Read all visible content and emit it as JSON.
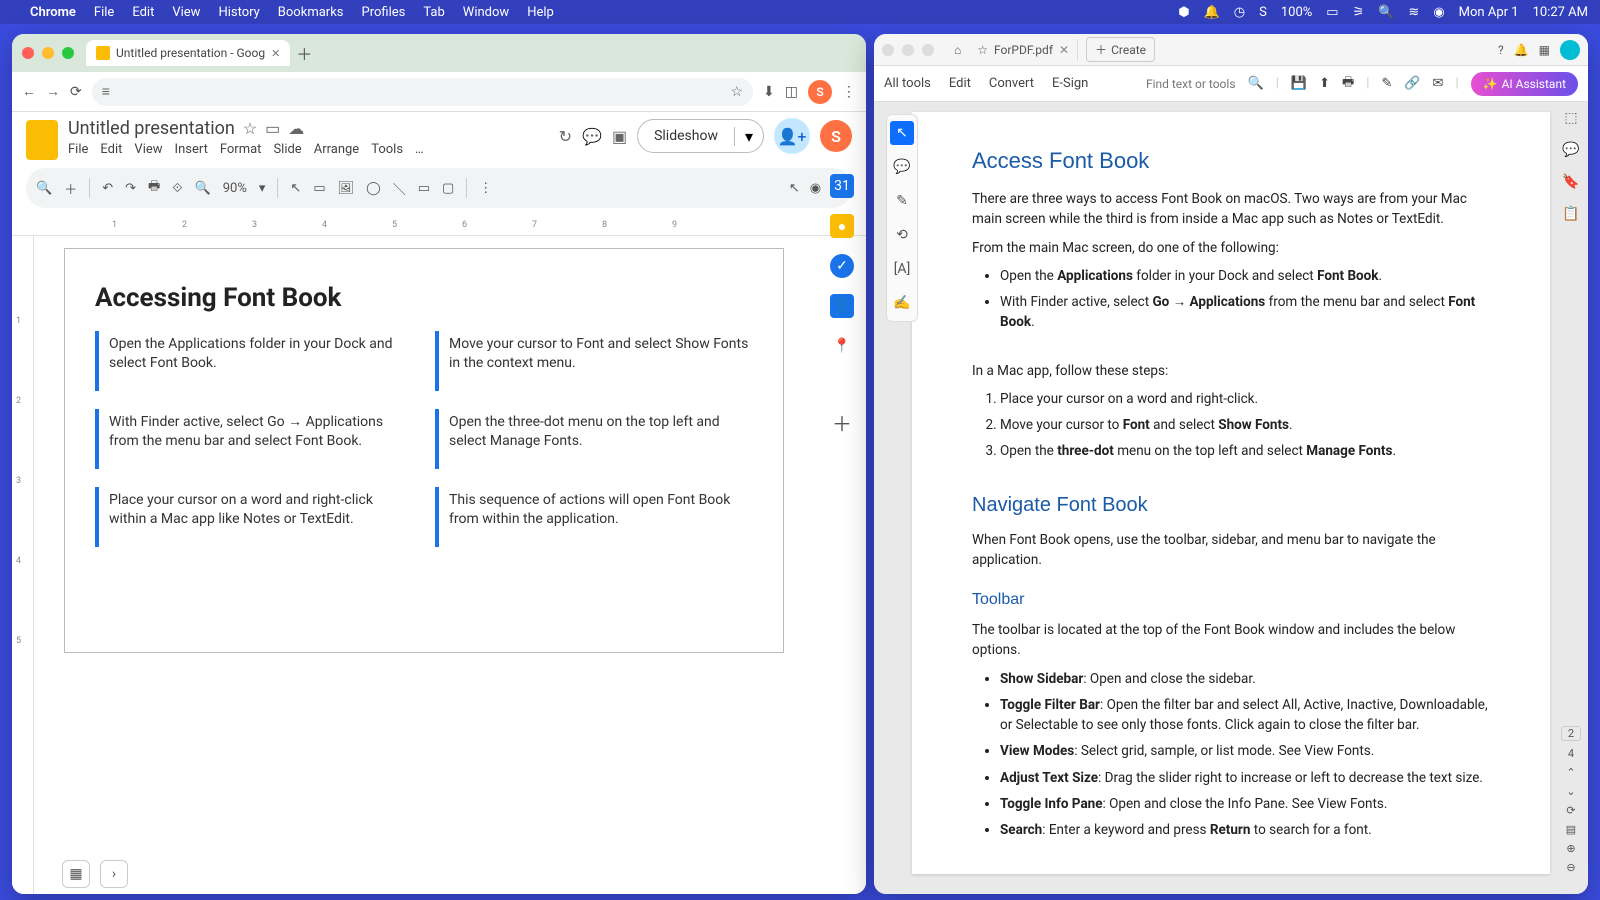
{
  "menubar": {
    "app": "Chrome",
    "items": [
      "File",
      "Edit",
      "View",
      "History",
      "Bookmarks",
      "Profiles",
      "Tab",
      "Window",
      "Help"
    ],
    "battery": "100%",
    "date": "Mon Apr 1",
    "time": "10:27 AM"
  },
  "chrome": {
    "tab_title": "Untitled presentation - Goog",
    "nav_icons": {
      "back": "←",
      "forward": "→",
      "reload": "⟳",
      "tune": "≡"
    },
    "addr_icons": {
      "star": "☆",
      "download": "⬇",
      "sidepanel": "◫",
      "menu": "⋮"
    },
    "avatar": "S"
  },
  "slides": {
    "doc_title": "Untitled presentation",
    "star": "☆",
    "folder": "▭",
    "cloud": "☁",
    "menus": [
      "File",
      "Edit",
      "View",
      "Insert",
      "Format",
      "Slide",
      "Arrange",
      "Tools",
      "…"
    ],
    "history": "↻",
    "comments": "💬",
    "meet": "▣",
    "slideshow": "Slideshow",
    "dd": "▾",
    "share": "👤+",
    "avatar": "S",
    "toolbar": {
      "search": "🔍",
      "new": "＋",
      "undo": "↶",
      "redo": "↷",
      "print": "🖶",
      "paint": "⟐",
      "zoomicon": "🔍",
      "zoom": "90%",
      "dd": "▾",
      "select": "↖",
      "textbox": "▭",
      "image": "🖼",
      "shape": "◯",
      "line": "＼",
      "connector": "▭",
      "transition": "▢",
      "more": "⋮",
      "cursor": "↖",
      "record": "◉",
      "collapse": "⌃"
    },
    "slide": {
      "title": "Accessing Font Book",
      "cards": [
        "Open the Applications folder in your Dock and select Font Book.",
        "Move your cursor to Font and select Show Fonts in the context menu.",
        "With Finder active, select Go → Applications from the menu bar and select Font Book.",
        "Open the three-dot menu on the top left and select Manage Fonts.",
        "Place your cursor on a word and right-click within a Mac app like Notes or TextEdit.",
        "This sequence of actions will open Font Book from within the application."
      ]
    },
    "ruler_h": [
      "1",
      "2",
      "3",
      "4",
      "5",
      "6",
      "7",
      "8",
      "9"
    ],
    "ruler_v": [
      "1",
      "2",
      "3",
      "4",
      "5"
    ]
  },
  "acrobat": {
    "home": "⌂",
    "star": "☆",
    "doc": "ForPDF.pdf",
    "close": "✕",
    "create": "Create",
    "top_icons": {
      "help": "?",
      "bell": "🔔",
      "grid": "▦"
    },
    "tabs": [
      "All tools",
      "Edit",
      "Convert",
      "E-Sign"
    ],
    "find": "Find text or tools",
    "search": "🔍",
    "tool_icons": [
      "💾",
      "⬆",
      "🖶",
      "",
      "✎",
      "🔗",
      "✉"
    ],
    "ai": "AI Assistant",
    "left_tools": [
      "↖",
      "💬",
      "✎",
      "⟲",
      "[A]",
      "✍"
    ],
    "right_tools": [
      "⬚",
      "💬",
      "🔖",
      "📋"
    ],
    "page": {
      "current": "2",
      "total": "4",
      "up": "⌃",
      "down": "⌄",
      "refresh": "⟳",
      "export": "▤",
      "zin": "⊕",
      "zout": "⊖"
    },
    "content": {
      "h1": "Access Font Book",
      "p1": "There are three ways to access Font Book on macOS. Two ways are from your Mac main screen while the third is from inside a Mac app such as Notes or TextEdit.",
      "p2": "From the main Mac screen, do one of the following:",
      "b1_pre": "Open the ",
      "b1_b1": "Applications",
      "b1_mid": " folder in your Dock and select ",
      "b1_b2": "Font Book",
      "b1_end": ".",
      "b2_pre": "With Finder active, select ",
      "b2_b1": "Go → Applications",
      "b2_mid": " from the menu bar and select ",
      "b2_b2": "Font Book",
      "b2_end": ".",
      "p3": "In a Mac app, follow these steps:",
      "ol1": "Place your cursor on a word and right-click.",
      "ol2_pre": "Move your cursor to ",
      "ol2_b1": "Font",
      "ol2_mid": " and select ",
      "ol2_b2": "Show Fonts",
      "ol2_end": ".",
      "ol3_pre": "Open the ",
      "ol3_b1": "three-dot",
      "ol3_mid": " menu on the top left and select ",
      "ol3_b2": "Manage Fonts",
      "ol3_end": ".",
      "h2": "Navigate Font Book",
      "p4": "When Font Book opens, use the toolbar, sidebar, and menu bar to navigate the application.",
      "h3": "Toolbar",
      "p5": "The toolbar is located at the top of the Font Book window and includes the below options.",
      "tb1_b": "Show Sidebar",
      "tb1": ": Open and close the sidebar.",
      "tb2_b": "Toggle Filter Bar",
      "tb2": ": Open the filter bar and select All, Active, Inactive, Downloadable, or Selectable to see only those fonts. Click again to close the filter bar.",
      "tb3_b": "View Modes",
      "tb3": ": Select grid, sample, or list mode. See View Fonts.",
      "tb4_b": "Adjust Text Size",
      "tb4": ": Drag the slider right to increase or left to decrease the text size.",
      "tb5_b": "Toggle Info Pane",
      "tb5": ": Open and close the Info Pane. See View Fonts.",
      "tb6_b": "Search",
      "tb6_pre": ": Enter a keyword and press ",
      "tb6_b2": "Return",
      "tb6_end": " to search for a font."
    }
  }
}
